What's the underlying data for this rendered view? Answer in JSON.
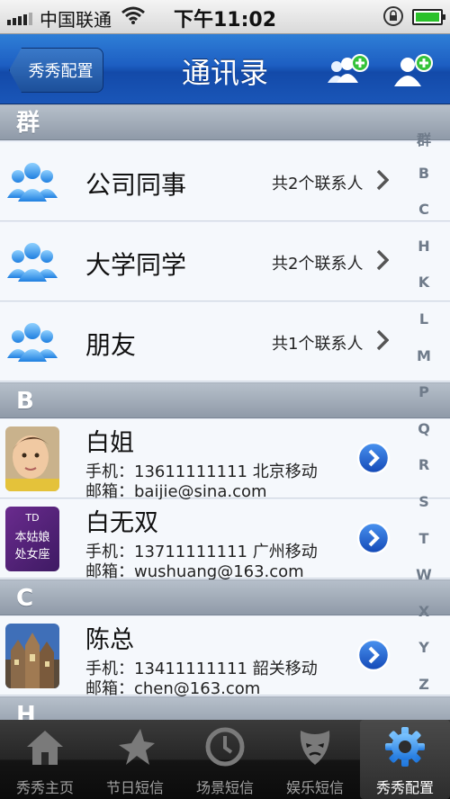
{
  "status_bar": {
    "carrier": "中国联通",
    "time": "下午11:02"
  },
  "nav": {
    "back_label": "秀秀配置",
    "title": "通讯录"
  },
  "sections": {
    "groups": {
      "header": "群"
    },
    "b": {
      "header": "B"
    },
    "c": {
      "header": "C"
    },
    "h": {
      "header": "H"
    }
  },
  "groups": [
    {
      "name": "公司同事",
      "count": "共2个联系人"
    },
    {
      "name": "大学同学",
      "count": "共2个联系人"
    },
    {
      "name": "朋友",
      "count": "共1个联系人"
    }
  ],
  "contacts": [
    {
      "name": "白姐",
      "phone": "手机：13611111111 北京移动",
      "email": "邮箱：baijie@sina.com"
    },
    {
      "name": "白无双",
      "phone": "手机：13711111111 广州移动",
      "email": "邮箱：wushuang@163.com"
    },
    {
      "name": "陈总",
      "phone": "手机：13411111111 韶关移动",
      "email": "邮箱：chen@163.com"
    }
  ],
  "avatar2_text": {
    "line1": "TD",
    "line2": "本姑娘",
    "line3": "处女座"
  },
  "index_letters": [
    "群",
    "B",
    "C",
    "H",
    "K",
    "L",
    "M",
    "P",
    "Q",
    "R",
    "S",
    "T",
    "W",
    "X",
    "Y",
    "Z"
  ],
  "tabs": [
    {
      "label": "秀秀主页",
      "icon": "home-icon"
    },
    {
      "label": "节日短信",
      "icon": "star-icon"
    },
    {
      "label": "场景短信",
      "icon": "clock-icon"
    },
    {
      "label": "娱乐短信",
      "icon": "mask-icon"
    },
    {
      "label": "秀秀配置",
      "icon": "gear-icon"
    }
  ],
  "colors": {
    "nav_blue": "#1d5ec2",
    "tab_active": "#2a85e0",
    "section_gray": "#9aa4b1",
    "battery_green": "#2bc12b"
  }
}
